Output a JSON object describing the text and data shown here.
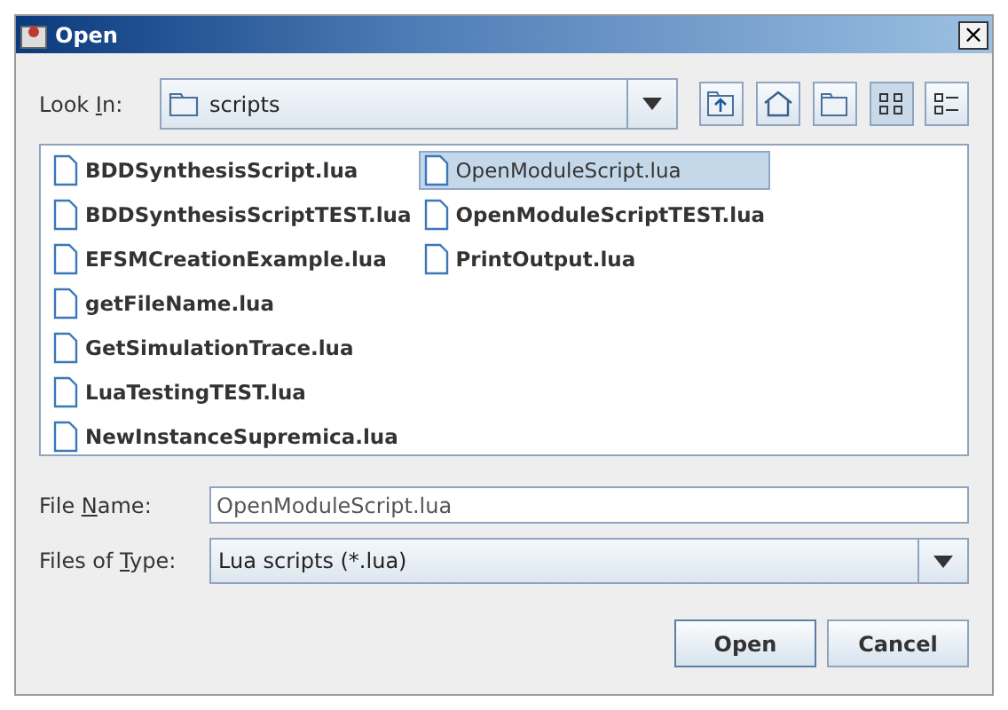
{
  "window": {
    "title": "Open",
    "close": "×"
  },
  "look_in": {
    "label": {
      "before": "Look ",
      "key": "I",
      "after": "n:"
    },
    "value": "scripts"
  },
  "toolbar": [
    {
      "kind": "up"
    },
    {
      "kind": "home"
    },
    {
      "kind": "new_folder"
    }
  ],
  "views": [
    {
      "kind": "list",
      "selected": true
    },
    {
      "kind": "details",
      "selected": false
    }
  ],
  "files": [
    {
      "name": "BDDSynthesisScript.lua",
      "selected": false
    },
    {
      "name": "BDDSynthesisScriptTEST.lua",
      "selected": false
    },
    {
      "name": "EFSMCreationExample.lua",
      "selected": false
    },
    {
      "name": "getFileName.lua",
      "selected": false
    },
    {
      "name": "GetSimulationTrace.lua",
      "selected": false
    },
    {
      "name": "LuaTestingTEST.lua",
      "selected": false
    },
    {
      "name": "NewInstanceSupremica.lua",
      "selected": false
    },
    {
      "name": "OpenModuleScript.lua",
      "selected": true
    },
    {
      "name": "OpenModuleScriptTEST.lua",
      "selected": false
    },
    {
      "name": "PrintOutput.lua",
      "selected": false
    }
  ],
  "file_name": {
    "label": {
      "before": "File ",
      "key": "N",
      "after": "ame:"
    },
    "value": "OpenModuleScript.lua"
  },
  "file_type": {
    "label": {
      "before": "Files of ",
      "key": "T",
      "after": "ype:"
    },
    "value": "Lua scripts (*.lua)"
  },
  "buttons": [
    "Open",
    "Cancel"
  ]
}
